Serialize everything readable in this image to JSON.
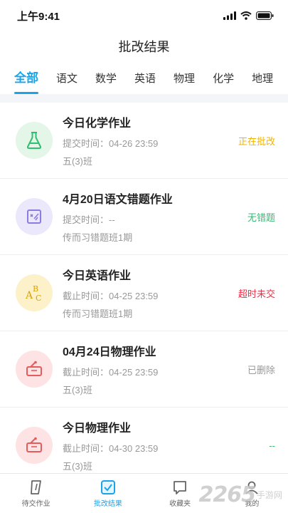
{
  "status_bar": {
    "time": "上午9:41"
  },
  "header": {
    "title": "批改结果"
  },
  "tabs": [
    {
      "label": "全部",
      "active": true
    },
    {
      "label": "语文",
      "active": false
    },
    {
      "label": "数学",
      "active": false
    },
    {
      "label": "英语",
      "active": false
    },
    {
      "label": "物理",
      "active": false
    },
    {
      "label": "化学",
      "active": false
    },
    {
      "label": "地理",
      "active": false
    }
  ],
  "homework": [
    {
      "icon": "flask-icon",
      "title": "今日化学作业",
      "meta": "提交时间：04-26 23:59",
      "class": "五(3)班",
      "status": "正在批改",
      "status_color": "#f0b400",
      "icon_bg": "#e3f6e8"
    },
    {
      "icon": "wrong-question-icon",
      "title": "4月20日语文错题作业",
      "meta": "提交时间：--",
      "class": "传而习错题班1期",
      "status": "无错题",
      "status_color": "#2fbf71",
      "icon_bg": "#ebe8fb"
    },
    {
      "icon": "abc-icon",
      "title": "今日英语作业",
      "meta": "截止时间：04-25 23:59",
      "class": "传而习错题班1期",
      "status": "超时未交",
      "status_color": "#e8324a",
      "icon_bg": "#fdf1c9"
    },
    {
      "icon": "physics-icon",
      "title": "04月24日物理作业",
      "meta": "截止时间：04-25 23:59",
      "class": "五(3)班",
      "status": "已删除",
      "status_color": "#999999",
      "icon_bg": "#fde3e3"
    },
    {
      "icon": "physics-icon",
      "title": "今日物理作业",
      "meta": "截止时间：04-30 23:59",
      "class": "五(3)班",
      "status": "--",
      "status_color": "#2fbf71",
      "icon_bg": "#fde3e3"
    }
  ],
  "bottom_nav": [
    {
      "label": "待交作业",
      "icon": "pending-homework-icon",
      "active": false
    },
    {
      "label": "批改结果",
      "icon": "graded-results-icon",
      "active": true
    },
    {
      "label": "收藏夹",
      "icon": "favorites-icon",
      "active": false
    },
    {
      "label": "我的",
      "icon": "profile-icon",
      "active": false
    }
  ],
  "watermark": {
    "digits": "2265",
    "text": "手游网"
  },
  "colors": {
    "accent": "#1aa3e8"
  }
}
